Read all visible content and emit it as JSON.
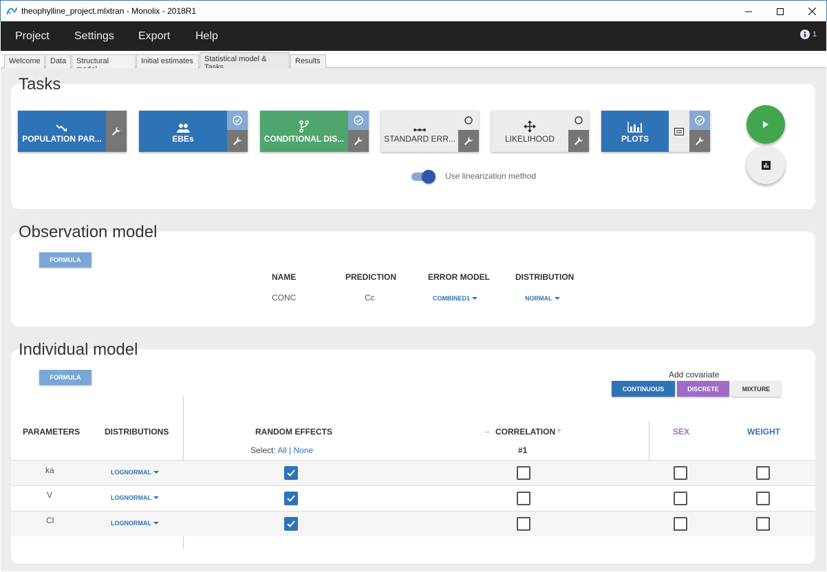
{
  "window": {
    "title": "theophylline_project.mlxtran - Monolix - 2018R1"
  },
  "menu": {
    "items": [
      "Project",
      "Settings",
      "Export",
      "Help"
    ],
    "info_count": "1"
  },
  "tabs": [
    {
      "label": "Welcome"
    },
    {
      "label": "Data"
    },
    {
      "label": "Structural model"
    },
    {
      "label": "Initial estimates"
    },
    {
      "label": "Statistical model & Tasks",
      "active": true
    },
    {
      "label": "Results"
    }
  ],
  "tasks": {
    "title": "Tasks",
    "buttons": [
      {
        "label": "POPULATION PAR...",
        "icon": "trend-down-icon",
        "status": ""
      },
      {
        "label": "EBEs",
        "icon": "people-icon",
        "status": "done"
      },
      {
        "label": "CONDITIONAL DIS...",
        "icon": "branch-icon",
        "status": "done"
      },
      {
        "label": "STANDARD ERR...",
        "icon": "dots-line-icon",
        "status": "pending"
      },
      {
        "label": "LIKELIHOOD",
        "icon": "move-arrows-icon",
        "status": "pending"
      },
      {
        "label": "PLOTS",
        "icon": "bar-chart-icon",
        "status": "done"
      }
    ],
    "linearization_label": "Use linearization method",
    "linearization_on": true
  },
  "observation_model": {
    "title": "Observation model",
    "formula_label": "FORMULA",
    "headers": {
      "name": "NAME",
      "prediction": "PREDICTION",
      "error_model": "ERROR MODEL",
      "distribution": "DISTRIBUTION"
    },
    "row": {
      "name": "CONC",
      "prediction": "Cc",
      "error_model": "COMBINED1",
      "distribution": "NORMAL"
    }
  },
  "individual_model": {
    "title": "Individual model",
    "formula_label": "FORMULA",
    "add_covariate_label": "Add covariate",
    "covariate_buttons": {
      "continuous": "CONTINUOUS",
      "discrete": "DISCRETE",
      "mixture": "MIXTURE"
    },
    "headers": {
      "parameters": "PARAMETERS",
      "distributions": "DISTRIBUTIONS",
      "random_effects": "RANDOM EFFECTS",
      "correlation": "CORRELATION",
      "correlation_minus": "−",
      "correlation_plus": "+",
      "correlation_group": "#1",
      "sex": "SEX",
      "weight": "WEIGHT"
    },
    "select": {
      "prefix": "Select:",
      "all": "All",
      "separator": "|",
      "none": "None"
    },
    "rows": [
      {
        "param": "ka",
        "distribution": "LOGNORMAL",
        "random_effect": true,
        "correlation": false,
        "sex": false,
        "weight": false
      },
      {
        "param": "V",
        "distribution": "LOGNORMAL",
        "random_effect": true,
        "correlation": false,
        "sex": false,
        "weight": false
      },
      {
        "param": "Cl",
        "distribution": "LOGNORMAL",
        "random_effect": true,
        "correlation": false,
        "sex": false,
        "weight": false
      }
    ]
  },
  "colors": {
    "accent_blue": "#2f73b7",
    "task_green": "#4fa56e",
    "discrete_purple": "#a06bc8",
    "run_green": "#43a64e",
    "menubar": "#222222"
  }
}
